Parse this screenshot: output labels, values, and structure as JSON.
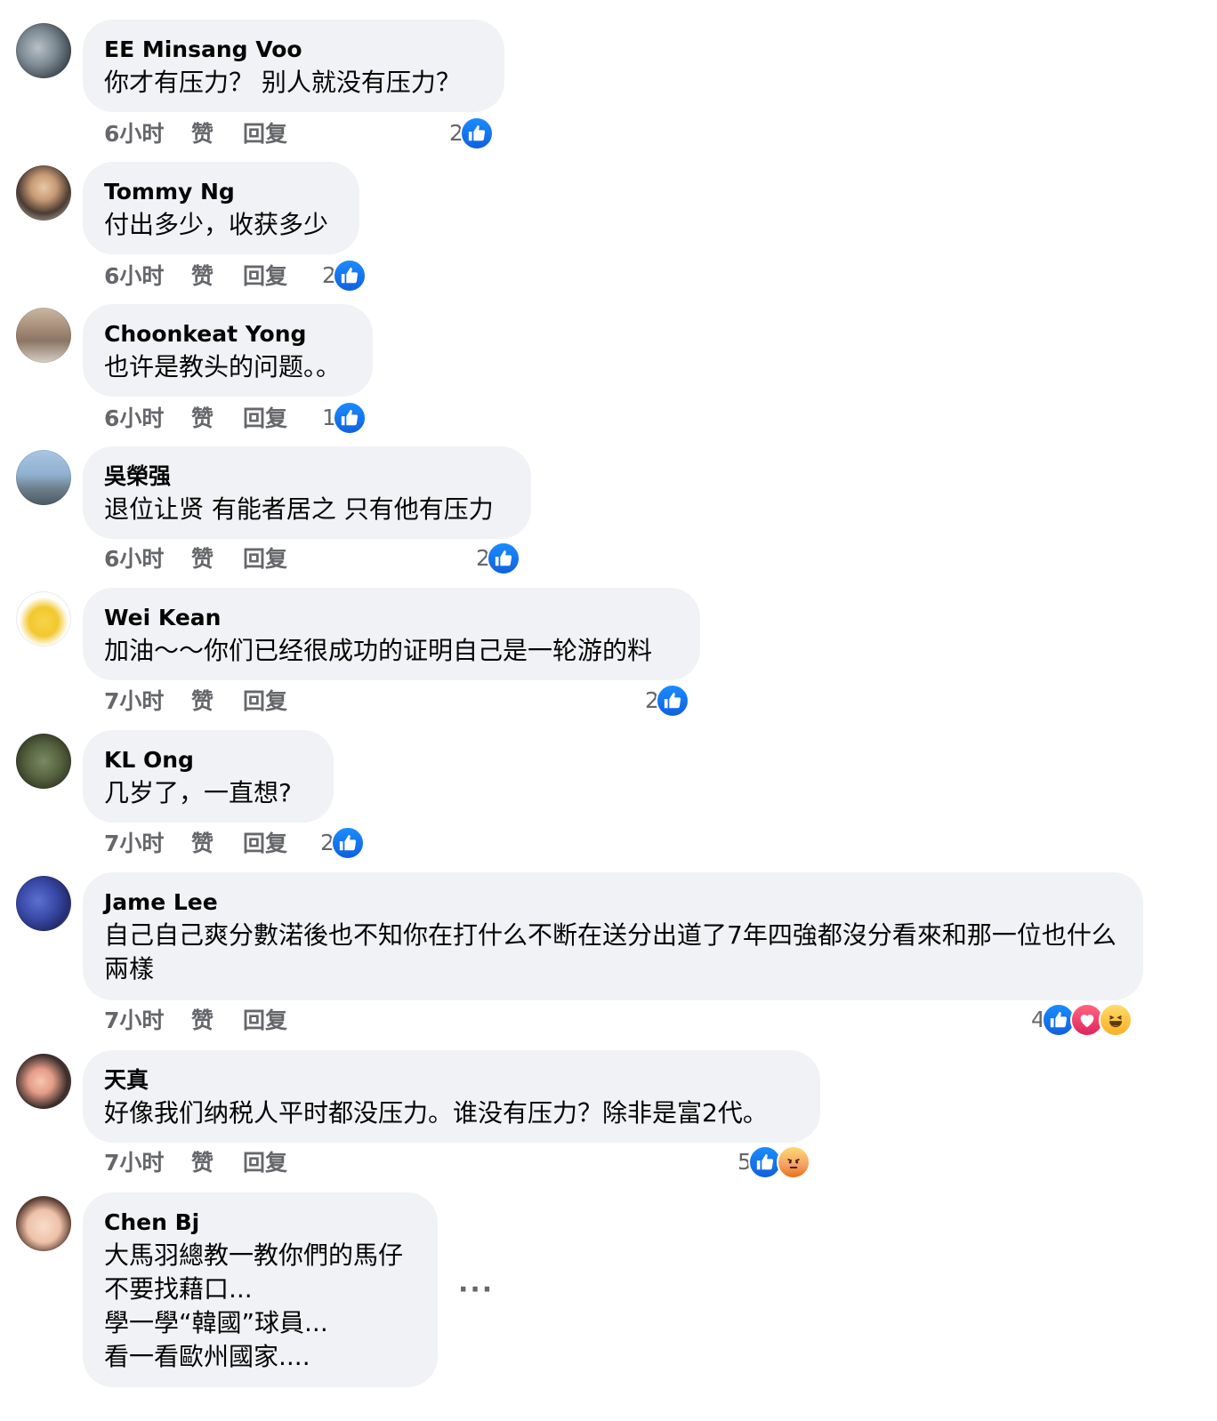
{
  "comments": [
    {
      "author": "EE Minsang Voo",
      "text": "你才有压力？ 别人就没有压力？",
      "time": "6小时",
      "like": "赞",
      "reply": "回复",
      "count": "2"
    },
    {
      "author": "Tommy Ng",
      "text": "付出多少，收获多少",
      "time": "6小时",
      "like": "赞",
      "reply": "回复",
      "count": "2"
    },
    {
      "author": "Choonkeat Yong",
      "text": "也许是教头的问题。。",
      "time": "6小时",
      "like": "赞",
      "reply": "回复",
      "count": "1"
    },
    {
      "author": "吳榮强",
      "text": "退位让贤 有能者居之 只有他有压力",
      "time": "6小时",
      "like": "赞",
      "reply": "回复",
      "count": "2"
    },
    {
      "author": "Wei Kean",
      "text": "加油～～你们已经很成功的证明自己是一轮游的料",
      "time": "7小时",
      "like": "赞",
      "reply": "回复",
      "count": "2"
    },
    {
      "author": "KL Ong",
      "text": "几岁了，一直想?",
      "time": "7小时",
      "like": "赞",
      "reply": "回复",
      "count": "2"
    },
    {
      "author": "Jame Lee",
      "text": "自己自己爽分數渃後也不知你在打什么不断在送分出道了7年四強都沒分看來和那一位也什么兩樣",
      "time": "7小时",
      "like": "赞",
      "reply": "回复",
      "count": "4"
    },
    {
      "author": "天真",
      "text": "好像我们纳税人平时都没压力。谁没有压力？除非是富2代。",
      "time": "7小时",
      "like": "赞",
      "reply": "回复",
      "count": "5"
    },
    {
      "author": "Chen Bj",
      "text": "大馬羽總教一教你們的馬仔\n不要找藉口...\n學一學“韓國”球員...\n看一看歐州國家....",
      "time": "",
      "like": "",
      "reply": "",
      "count": ""
    }
  ],
  "more_options": "···",
  "icons": {
    "like": "thumbs-up-icon",
    "love": "heart-icon",
    "haha": "laughing-face-icon",
    "angry": "angry-face-icon"
  },
  "colors": {
    "bubble": "#f0f2f5",
    "secondary_text": "#65676b",
    "like_blue": "#1877f2"
  }
}
